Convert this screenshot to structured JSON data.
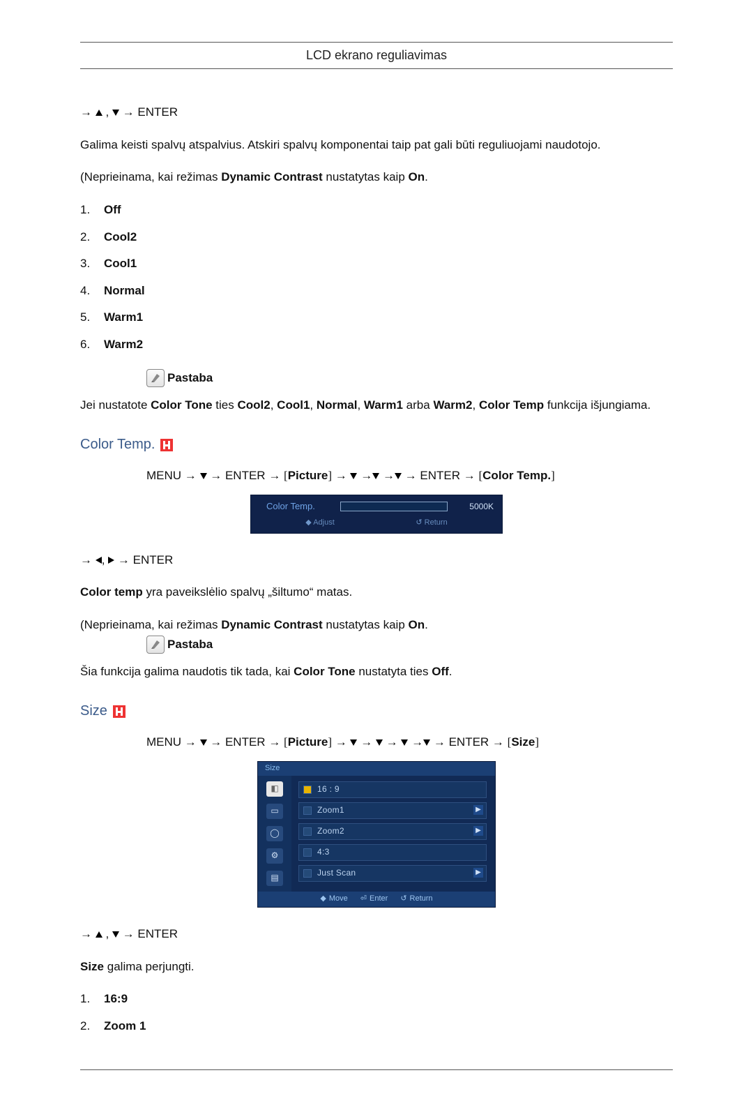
{
  "header": {
    "title": "LCD ekrano reguliavimas"
  },
  "nav1": {
    "enter": "ENTER"
  },
  "intro": {
    "p1": "Galima keisti spalvų atspalvius. Atskiri spalvų komponentai taip pat gali būti reguliuojami naudotojo.",
    "p2_pre": "(Neprieinama, kai režimas ",
    "p2_dc": "Dynamic Contrast",
    "p2_mid": " nustatytas kaip ",
    "p2_on": "On",
    "p2_end": "."
  },
  "color_tone_options": [
    "Off",
    "Cool2",
    "Cool1",
    "Normal",
    "Warm1",
    "Warm2"
  ],
  "note_label": "Pastaba",
  "note1": {
    "pre": "Jei nustatote ",
    "ct": "Color Tone",
    "mid1": " ties ",
    "o1": "Cool2",
    "o2": "Cool1",
    "o3": "Normal",
    "o4": "Warm1",
    "or": " arba ",
    "o5": "Warm2",
    "sep": ", ",
    "ctemp": "Color Temp",
    "tail": " funkcija išjungiama."
  },
  "section_ct": {
    "title": "Color Temp."
  },
  "path_ct": {
    "menu": "MENU",
    "enter": "ENTER",
    "picture": "Picture",
    "colortemp": "Color Temp."
  },
  "osd_ct": {
    "label": "Color Temp.",
    "value": "5000K",
    "adjust": "Adjust",
    "return": "Return"
  },
  "nav2": {
    "enter": "ENTER"
  },
  "ct_body": {
    "p1_pre": "",
    "p1_ct": "Color temp",
    "p1_post": " yra paveikslėlio spalvų „šiltumo“ matas.",
    "p2_pre": "(Neprieinama, kai režimas ",
    "p2_dc": "Dynamic Contrast",
    "p2_mid": " nustatytas kaip ",
    "p2_on": "On",
    "p2_end": "."
  },
  "note2": {
    "pre": "Šia funkcija galima naudotis tik tada, kai ",
    "ct": "Color Tone",
    "mid": " nustatyta ties ",
    "off": "Off",
    "end": "."
  },
  "section_size": {
    "title": "Size"
  },
  "path_size": {
    "menu": "MENU",
    "enter": "ENTER",
    "picture": "Picture",
    "size": "Size"
  },
  "osd_size": {
    "title": "Size",
    "items": {
      "i0": "16 : 9",
      "i1": "Zoom1",
      "i2": "Zoom2",
      "i3": "4:3",
      "i4": "Just Scan"
    },
    "footer": {
      "move": "Move",
      "enter": "Enter",
      "return": "Return"
    }
  },
  "nav3": {
    "enter": "ENTER"
  },
  "size_body": {
    "p1_pre": "",
    "p1_size": "Size",
    "p1_post": " galima perjungti."
  },
  "size_options": [
    "16:9",
    "Zoom 1"
  ]
}
